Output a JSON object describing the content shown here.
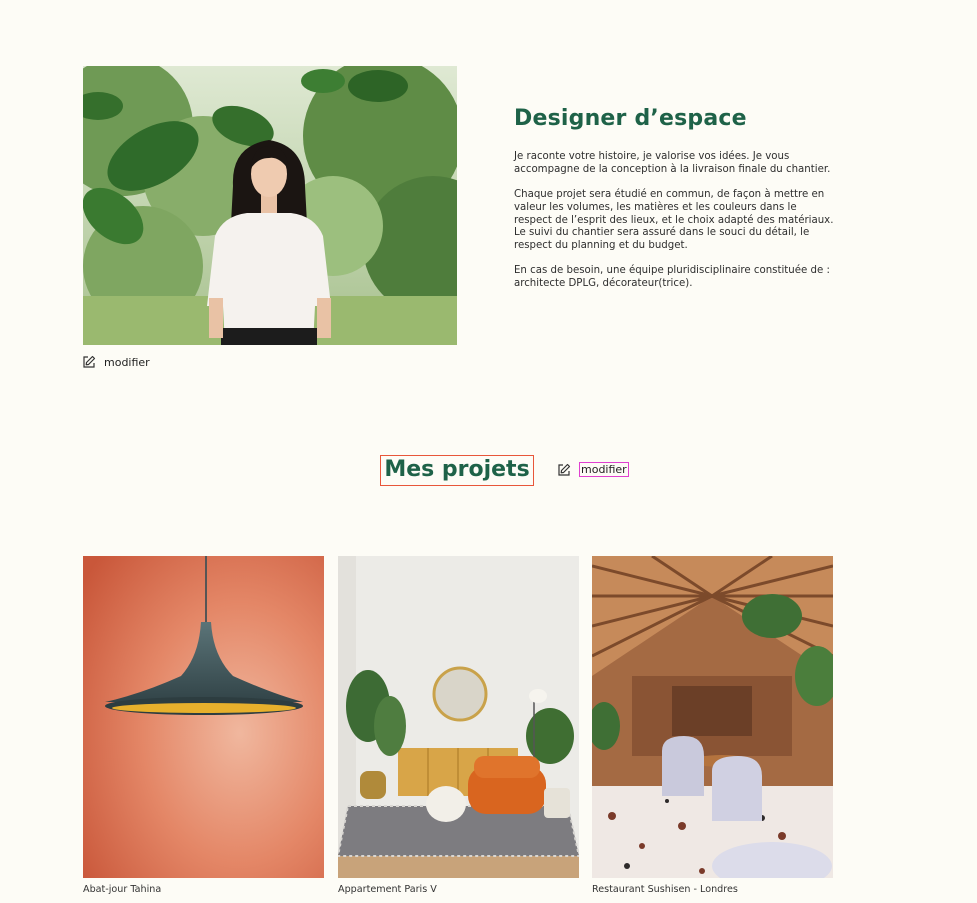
{
  "about": {
    "title": "Designer d’espace",
    "paragraphs": [
      "Je raconte votre histoire, je valorise vos idées. Je vous accompagne de la conception à la livraison finale du chantier.",
      "Chaque projet sera étudié en commun, de façon à mettre en valeur les volumes, les matières et les couleurs dans le respect de l’esprit des lieux, et le choix adapté des matériaux. Le suivi du chantier sera assuré dans le souci du détail, le respect du planning et du budget.",
      "En cas de besoin, une équipe pluridisciplinaire constituée de : architecte DPLG, décorateur(trice)."
    ],
    "edit_label": "modifier"
  },
  "projects": {
    "title": "Mes projets",
    "edit_label": "modifier",
    "items": [
      {
        "caption": "Abat-jour Tahina"
      },
      {
        "caption": "Appartement Paris V"
      },
      {
        "caption": "Restaurant Sushisen - Londres"
      }
    ]
  },
  "colors": {
    "background": "#fdfcf6",
    "heading": "#1e6248",
    "title_outline": "#e8563a",
    "edit_outline": "#e040d0"
  },
  "icons": {
    "edit": "edit-icon"
  }
}
